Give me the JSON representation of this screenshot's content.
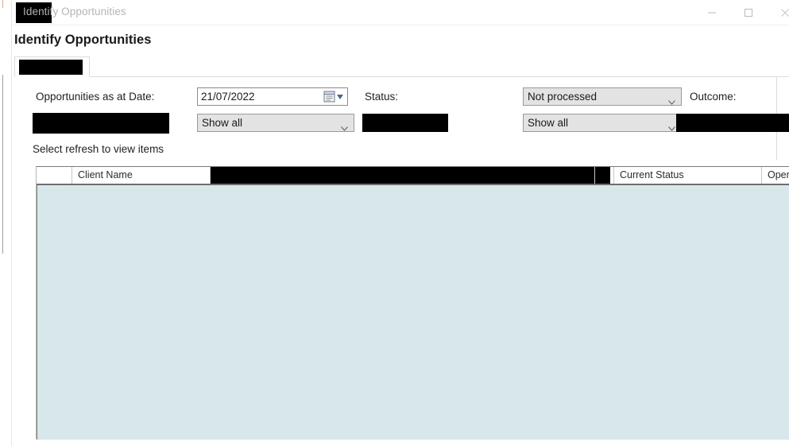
{
  "window": {
    "title": "Identify Opportunities",
    "icon_redacted": true,
    "controls": {
      "minimize": "minimize-icon",
      "maximize": "maximize-icon",
      "close": "close-icon"
    }
  },
  "page": {
    "heading": "Identify Opportunities"
  },
  "tabs": [
    {
      "label": "",
      "redacted": true,
      "active": true
    }
  ],
  "filters": {
    "date_label": "Opportunities as at Date:",
    "date_value": "21/07/2022",
    "date_picker_icon": "calendar-dropdown-icon",
    "status_label": "Status:",
    "status_value": "Not processed",
    "outcome_label": "Outcome:",
    "show_all_left": "Show all",
    "show_all_right": "Show all",
    "redacted_left_field": "",
    "redacted_status_field": "",
    "redacted_outcome_field": ""
  },
  "hint": "Select refresh to view items",
  "grid": {
    "columns": [
      {
        "label": "",
        "redacted": false,
        "kind": "select"
      },
      {
        "label": "Client Name",
        "redacted": false,
        "kind": "text"
      },
      {
        "label": "",
        "redacted": true,
        "kind": "text"
      },
      {
        "label": "",
        "redacted": true,
        "kind": "narrow"
      },
      {
        "label": "Current Status",
        "redacted": false,
        "kind": "text"
      },
      {
        "label": "Open",
        "redacted": false,
        "kind": "text"
      }
    ],
    "rows": [],
    "empty": true,
    "body_color": "#d8e8ea"
  },
  "colors": {
    "window_bg": "#ffffff",
    "title_text": "#b5b5b5",
    "heading_text": "#1a1a1a",
    "combo_bg": "#e3e3e3",
    "grid_body": "#d8e8ea",
    "redaction": "#000000",
    "accent_stripe": "#d9a79a"
  }
}
